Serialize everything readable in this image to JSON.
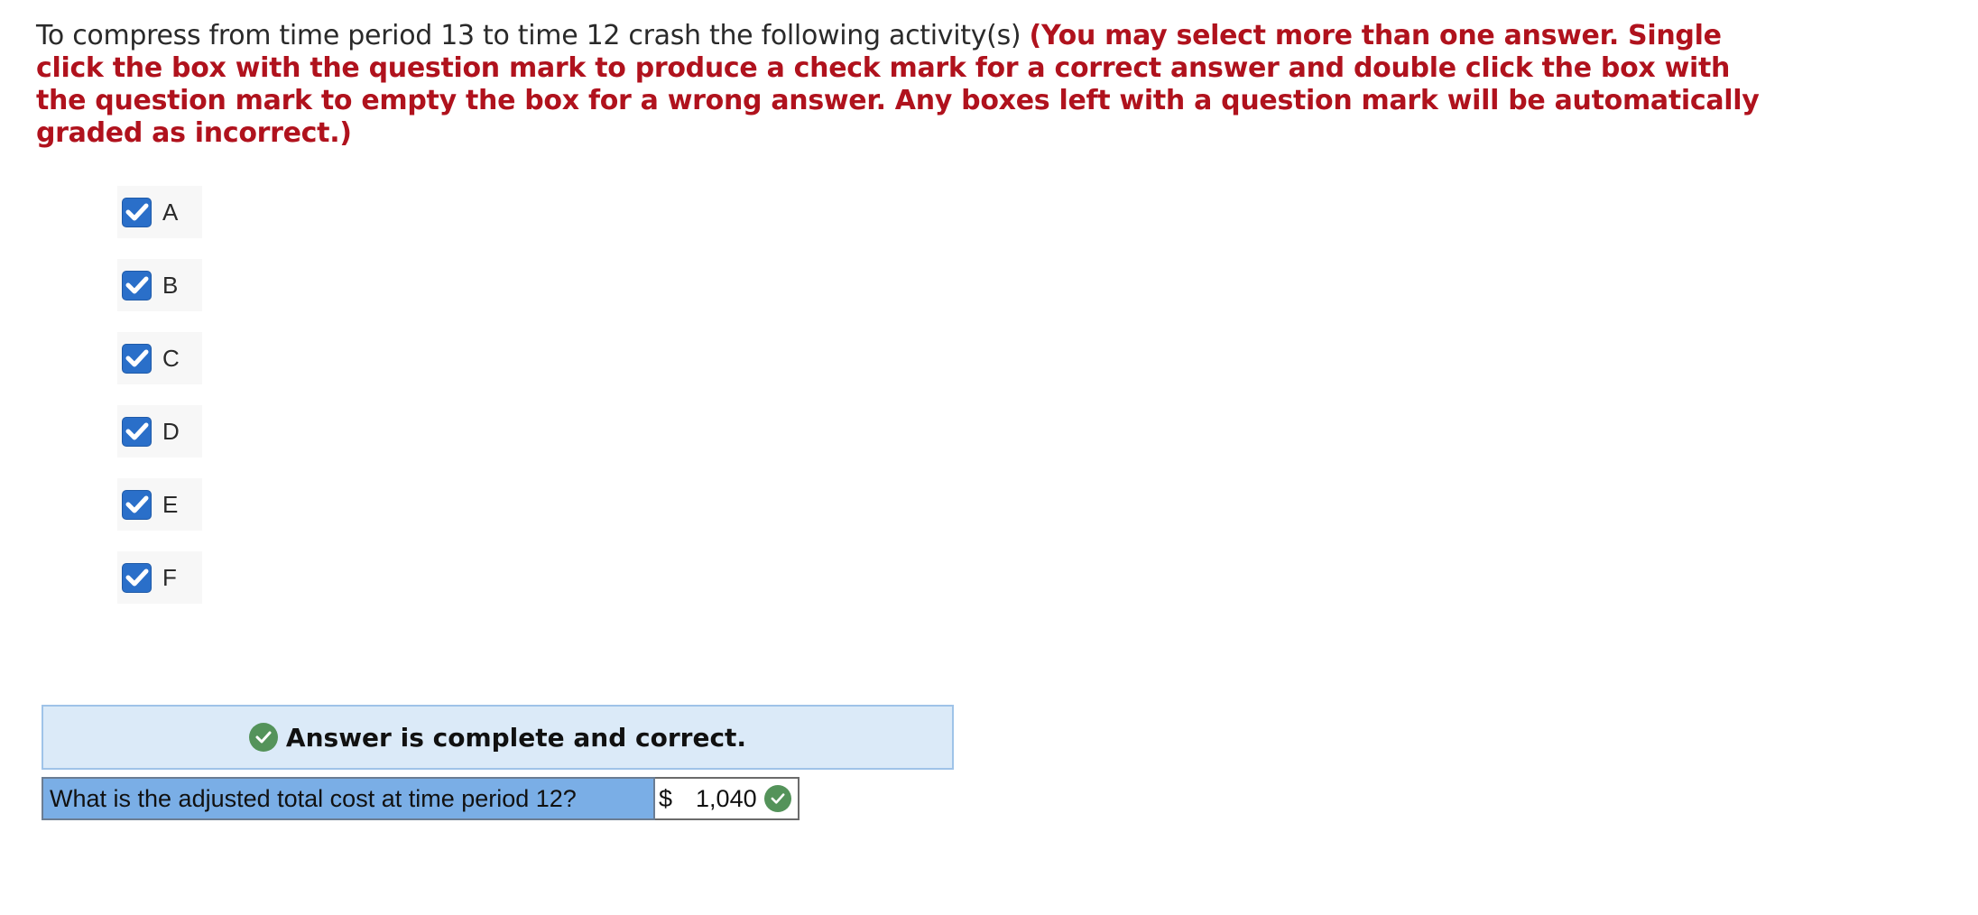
{
  "question": {
    "prompt": "To compress from time period 13 to time 12 crash the following activity(s) ",
    "instructions": "(You may select more than one answer. Single click the box with the question mark to produce a check mark for a correct answer and double click the box with the question mark to empty the box for a wrong answer. Any boxes left with a question mark will be automatically graded as incorrect.)"
  },
  "options": [
    {
      "label": "A",
      "checked": true
    },
    {
      "label": "B",
      "checked": true
    },
    {
      "label": "C",
      "checked": true
    },
    {
      "label": "D",
      "checked": true
    },
    {
      "label": "E",
      "checked": true
    },
    {
      "label": "F",
      "checked": true
    }
  ],
  "result": {
    "status_text": "Answer is complete and correct.",
    "status_icon": "check-circle-icon"
  },
  "followup": {
    "question_text": "What is the adjusted total cost at time period 12?",
    "currency": "$",
    "value": "1,040",
    "status_icon": "check-circle-icon"
  },
  "colors": {
    "instruction_red": "#b0121d",
    "checkbox_blue": "#2a6fc9",
    "banner_bg": "#dbeaf8",
    "question_bg": "#7aaee6",
    "correct_green": "#54935a"
  }
}
